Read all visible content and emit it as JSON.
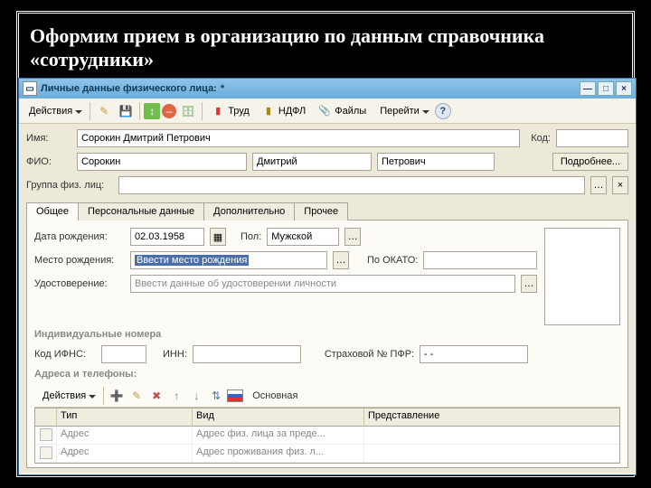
{
  "slide": {
    "title": "Оформим прием в организацию по данным справочника «сотрудники»"
  },
  "window": {
    "title": "Личные данные физического лица:",
    "modified_mark": "*"
  },
  "toolbar": {
    "actions": "Действия",
    "trud": "Труд",
    "ndfl": "НДФЛ",
    "files": "Файлы",
    "goto": "Перейти",
    "help": "?"
  },
  "fields": {
    "name_lbl": "Имя:",
    "fio_lbl": "ФИО:",
    "group_lbl": "Группа физ. лиц:",
    "code_lbl": "Код:",
    "more_btn": "Подробнее...",
    "name_val": "Сорокин Дмитрий Петрович",
    "surname": "Сорокин",
    "first": "Дмитрий",
    "patronym": "Петрович",
    "group_val": "",
    "code_val": ""
  },
  "tabs": {
    "general": "Общее",
    "personal": "Персональные данные",
    "additional": "Дополнительно",
    "other": "Прочее"
  },
  "general_tab": {
    "dob_lbl": "Дата рождения:",
    "dob_val": "02.03.1958",
    "sex_lbl": "Пол:",
    "sex_val": "Мужской",
    "pob_lbl": "Место рождения:",
    "pob_val": "Ввести место рождения",
    "okato_lbl": "По ОКАТО:",
    "okato_val": "",
    "id_lbl": "Удостоверение:",
    "id_ph": "Ввести данные об удостоверении личности",
    "ind_num_lbl": "Индивидуальные номера",
    "ifns_lbl": "Код ИФНС:",
    "ifns_val": "",
    "inn_lbl": "ИНН:",
    "inn_val": "",
    "pfr_lbl": "Страховой № ПФР:",
    "pfr_val": "-   -"
  },
  "addr_section": {
    "title": "Адреса и телефоны:",
    "actions": "Действия",
    "main": "Основная",
    "col_type": "Тип",
    "col_kind": "Вид",
    "col_repr": "Представление",
    "row1_type": "Адрес",
    "row1_kind": "Адрес физ. лица за преде...",
    "row2_type": "Адрес",
    "row2_kind": "Адрес проживания физ. л..."
  }
}
